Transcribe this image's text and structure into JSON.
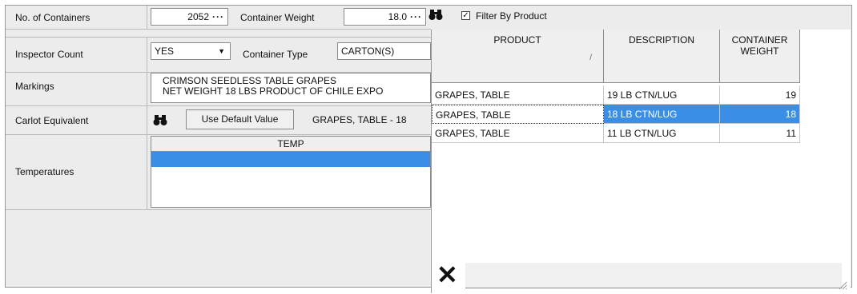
{
  "form": {
    "containers_label": "No. of Containers",
    "containers_value": "2052",
    "weight_label": "Container Weight",
    "weight_value": "18.0",
    "ellipsis": "···",
    "filter_label": "Filter By Product",
    "filter_checked": true,
    "inspector_label": "Inspector Count",
    "inspector_value": "YES",
    "type_label": "Container Type",
    "type_value": "CARTON(S)",
    "markings_label": "Markings",
    "markings_line1": "CRIMSON SEEDLESS TABLE GRAPES",
    "markings_line2": "NET WEIGHT 18 LBS  PRODUCT OF CHILE  EXPO",
    "carlot_label": "Carlot Equivalent",
    "default_button": "Use Default Value",
    "carlot_value": "GRAPES, TABLE - 18",
    "temperatures_label": "Temperatures",
    "temp_header": "TEMP"
  },
  "grid": {
    "headers": [
      "PRODUCT",
      "DESCRIPTION",
      "CONTAINER WEIGHT"
    ],
    "header_weight_line1": "CONTAINER",
    "header_weight_line2": "WEIGHT",
    "sort_glyph": "/",
    "rows": [
      {
        "product": "GRAPES, TABLE",
        "description": "19 LB CTN/LUG",
        "weight": "19"
      },
      {
        "product": "GRAPES, TABLE",
        "description": "18 LB CTN/LUG",
        "weight": "18"
      },
      {
        "product": "GRAPES, TABLE",
        "description": "11 LB CTN/LUG",
        "weight": "11"
      }
    ],
    "selected_row": 1,
    "close_glyph": "✕"
  },
  "colors": {
    "selection": "#3a8ee6",
    "temp_row": "#3a8ee6"
  }
}
